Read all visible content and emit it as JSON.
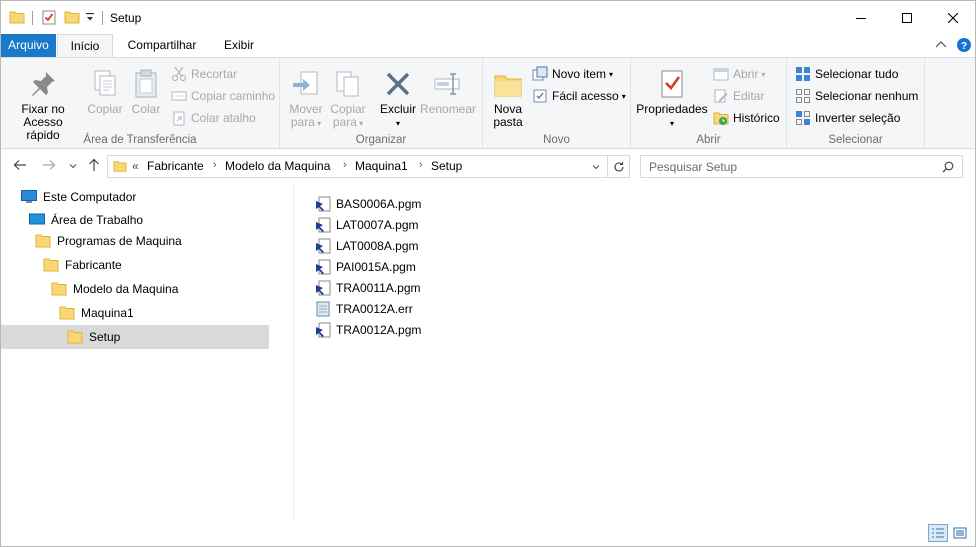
{
  "window": {
    "title": "Setup",
    "minimize": "–",
    "maximize": "□",
    "close": "✕"
  },
  "tabs": {
    "file": "Arquivo",
    "home": "Início",
    "share": "Compartilhar",
    "view": "Exibir"
  },
  "ribbon": {
    "clipboard": {
      "label": "Área de Transferência",
      "pin": [
        "Fixar no",
        "Acesso rápido"
      ],
      "copy": "Copiar",
      "paste": "Colar",
      "cut": "Recortar",
      "copy_path": "Copiar caminho",
      "paste_shortcut": "Colar atalho"
    },
    "organize": {
      "label": "Organizar",
      "move_to": [
        "Mover",
        "para"
      ],
      "copy_to": [
        "Copiar",
        "para"
      ],
      "delete": "Excluir",
      "rename": "Renomear"
    },
    "new": {
      "label": "Novo",
      "new_folder": [
        "Nova",
        "pasta"
      ],
      "new_item": "Novo item",
      "easy_access": "Fácil acesso"
    },
    "open": {
      "label": "Abrir",
      "properties": "Propriedades",
      "open": "Abrir",
      "edit": "Editar",
      "history": "Histórico"
    },
    "select": {
      "label": "Selecionar",
      "select_all": "Selecionar tudo",
      "select_none": "Selecionar nenhum",
      "invert": "Inverter seleção"
    }
  },
  "address": {
    "overflow": "«",
    "crumbs": [
      "Fabricante",
      "Modelo da Maquina",
      "Maquina1",
      "Setup"
    ],
    "search_placeholder": "Pesquisar Setup"
  },
  "tree": [
    {
      "label": "Este Computador",
      "icon": "computer-icon"
    },
    {
      "label": "Área de Trabalho",
      "icon": "desktop-icon"
    },
    {
      "label": "Programas de Maquina",
      "icon": "folder-icon"
    },
    {
      "label": "Fabricante",
      "icon": "folder-icon"
    },
    {
      "label": "Modelo da Maquina",
      "icon": "folder-icon"
    },
    {
      "label": "Maquina1",
      "icon": "folder-icon"
    },
    {
      "label": "Setup",
      "icon": "folder-icon"
    }
  ],
  "files": [
    {
      "name": "BAS0006A.pgm",
      "icon": "pgm-file-icon"
    },
    {
      "name": "LAT0007A.pgm",
      "icon": "pgm-file-icon"
    },
    {
      "name": "LAT0008A.pgm",
      "icon": "pgm-file-icon"
    },
    {
      "name": "PAI0015A.pgm",
      "icon": "pgm-file-icon"
    },
    {
      "name": "TRA0011A.pgm",
      "icon": "pgm-file-icon"
    },
    {
      "name": "TRA0012A.err",
      "icon": "err-file-icon"
    },
    {
      "name": "TRA0012A.pgm",
      "icon": "pgm-file-icon"
    }
  ],
  "colors": {
    "file_tab": "#1979ca",
    "folder": "#f8d775",
    "selection": "#d9d9d9",
    "help": "#1a73d9"
  }
}
